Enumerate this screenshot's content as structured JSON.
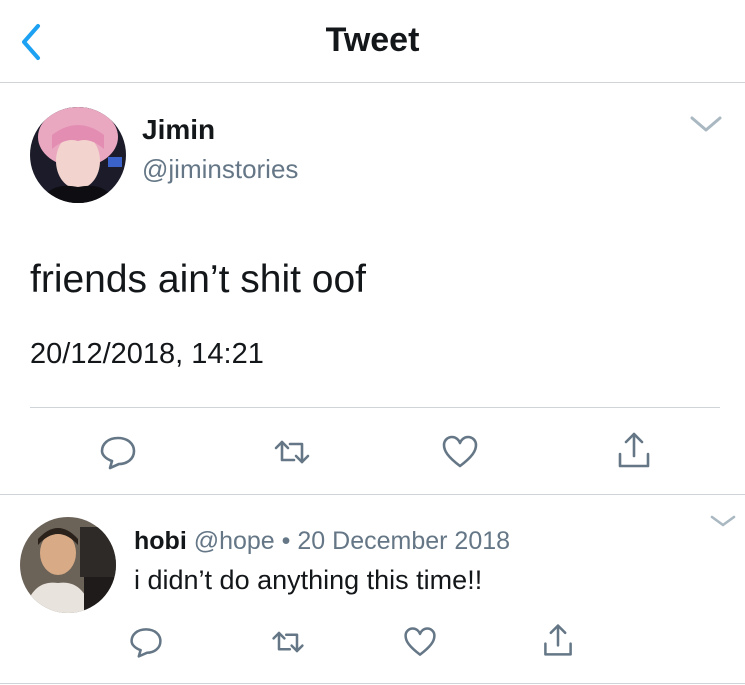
{
  "header": {
    "title": "Tweet",
    "back_icon": "chevron-left-icon",
    "accent": "#1da1f2"
  },
  "tweet": {
    "name": "Jimin",
    "handle": "@jiminstories",
    "text": "friends ain’t shit oof",
    "timestamp": "20/12/2018, 14:21",
    "actions": [
      "reply-icon",
      "retweet-icon",
      "like-icon",
      "share-icon"
    ]
  },
  "reply": {
    "name": "hobi",
    "handle": "@hope",
    "separator": "•",
    "date": "20 December 2018",
    "text": "i didn’t do anything this time!!",
    "actions": [
      "reply-icon",
      "retweet-icon",
      "like-icon",
      "share-icon"
    ]
  },
  "colors": {
    "text": "#14171a",
    "secondary": "#657786",
    "divider": "#cfd4d8"
  }
}
